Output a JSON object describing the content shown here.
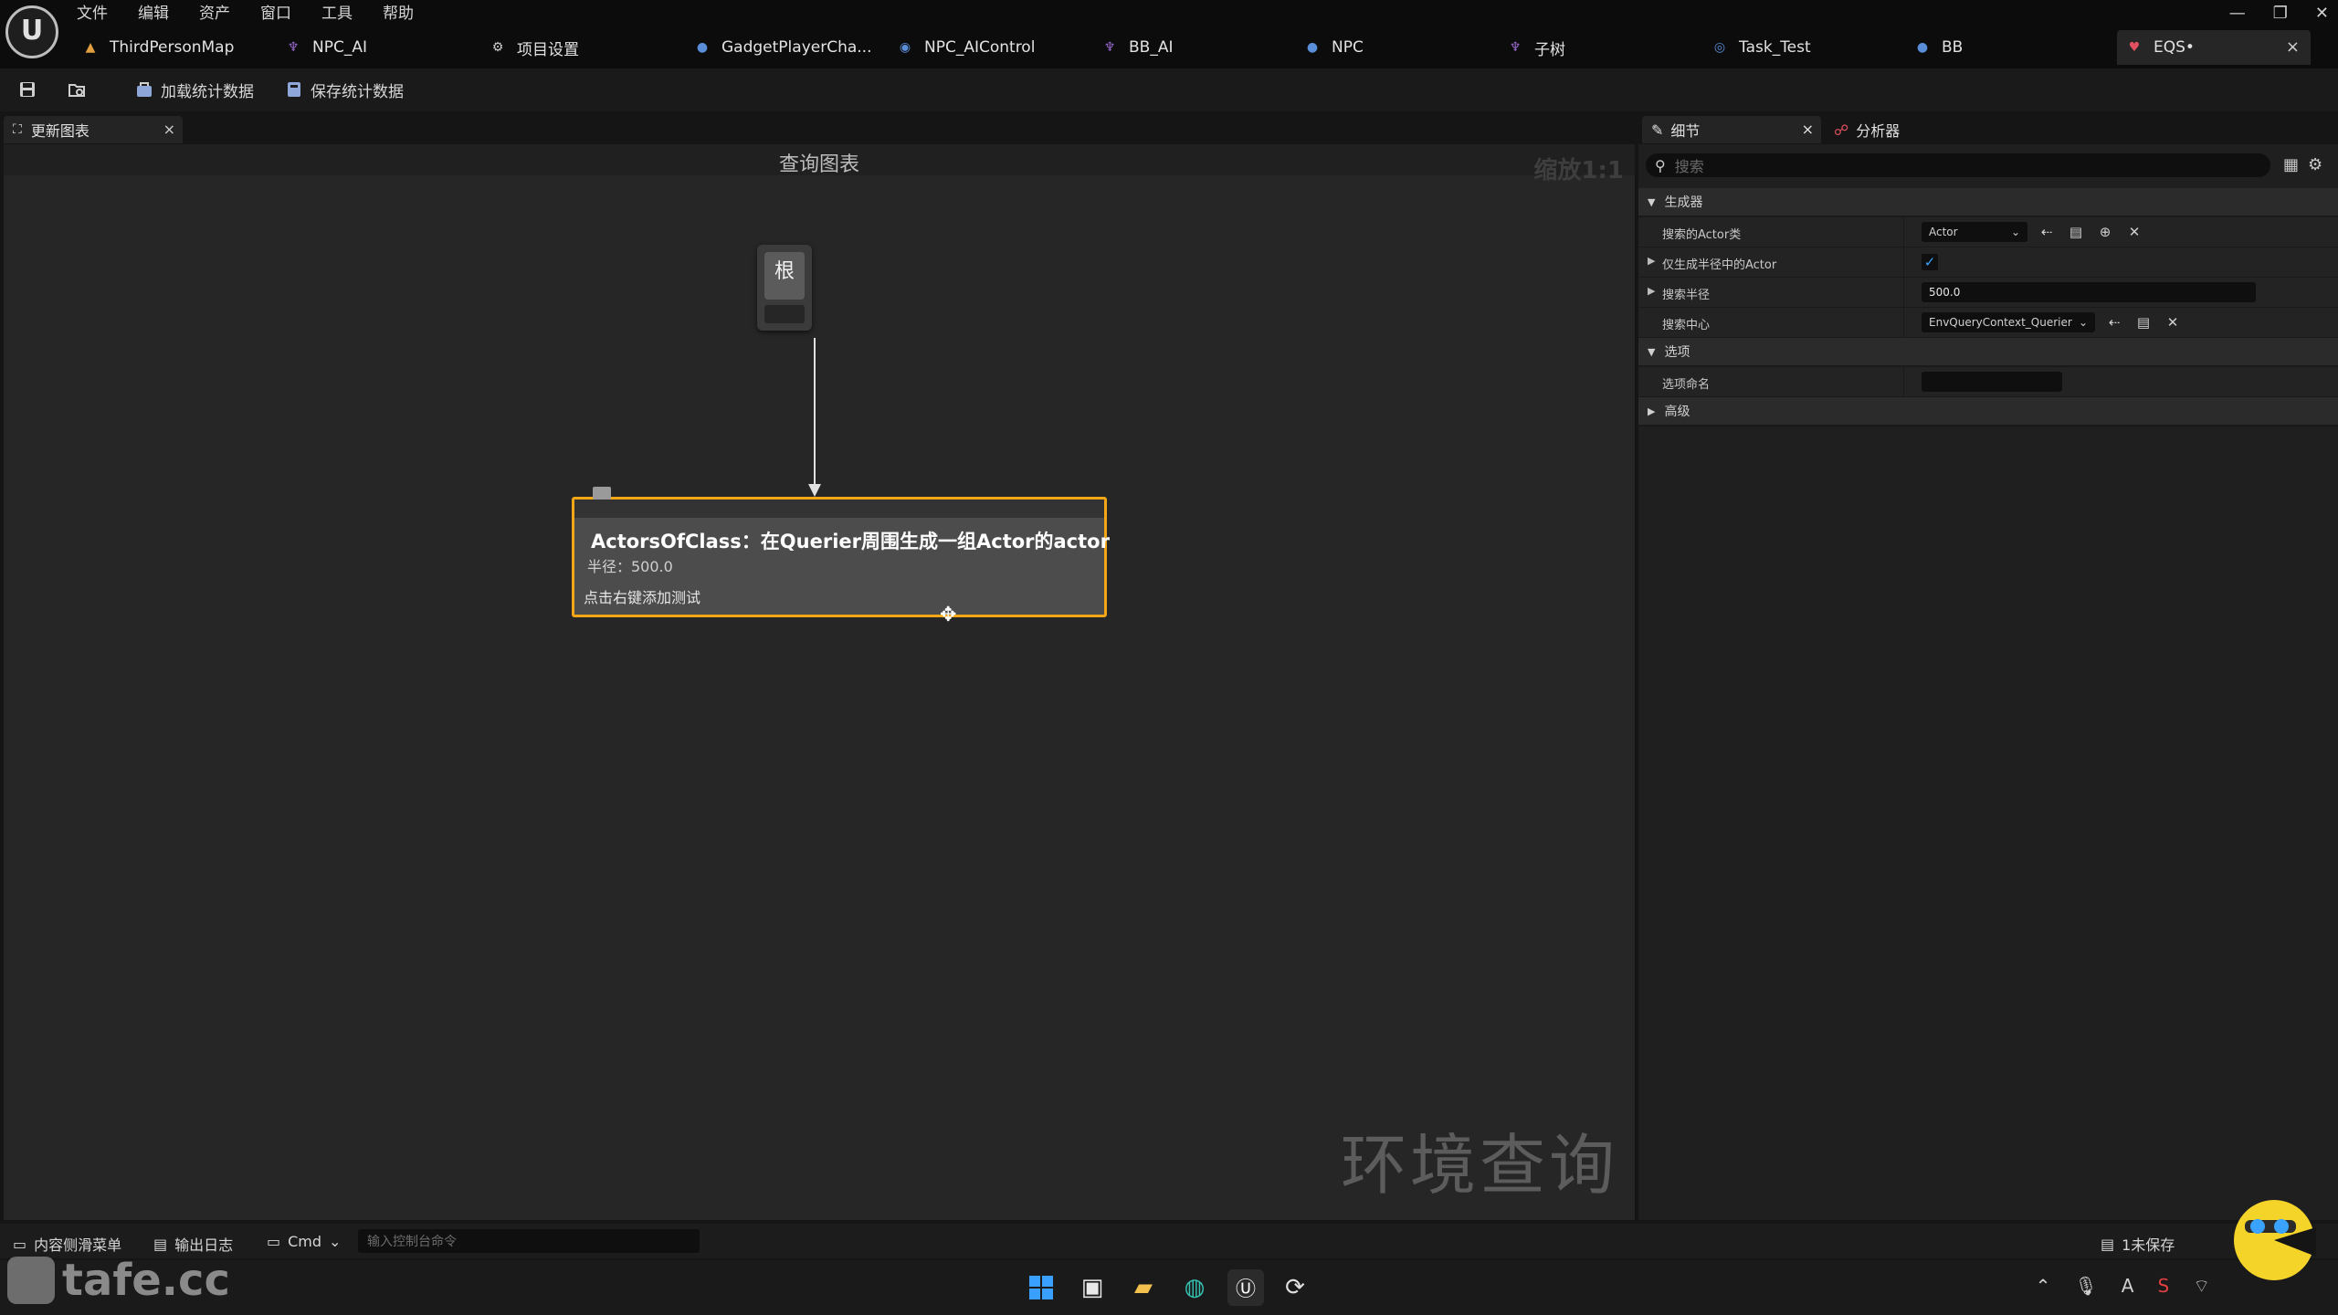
{
  "menu": [
    "文件",
    "编辑",
    "资产",
    "窗口",
    "工具",
    "帮助"
  ],
  "tabs": [
    {
      "label": "ThirdPersonMap",
      "icon": "map-icon"
    },
    {
      "label": "NPC_AI",
      "icon": "behavior-tree-icon"
    },
    {
      "label": "项目设置",
      "icon": "settings-icon"
    },
    {
      "label": "GadgetPlayerCha...",
      "icon": "blueprint-character-icon"
    },
    {
      "label": "NPC_AIControl",
      "icon": "ai-controller-icon"
    },
    {
      "label": "BB_AI",
      "icon": "behavior-tree-icon"
    },
    {
      "label": "NPC",
      "icon": "blueprint-character-icon"
    },
    {
      "label": "子树",
      "icon": "behavior-tree-icon"
    },
    {
      "label": "Task_Test",
      "icon": "task-icon"
    },
    {
      "label": "BB",
      "icon": "blueprint-character-icon"
    },
    {
      "label": "EQS•",
      "icon": "eqs-icon",
      "active": true
    }
  ],
  "toolbar": {
    "load_stats": "加载统计数据",
    "save_stats": "保存统计数据"
  },
  "graph": {
    "tab_label": "更新图表",
    "title": "查询图表",
    "zoom": "缩放1:1",
    "watermark": "环境查询",
    "root_label": "根",
    "generator": {
      "title": "ActorsOfClass：在Querier周围生成一组Actor的actor",
      "subtitle": "半径：500.0",
      "hint": "点击右键添加测试"
    }
  },
  "details": {
    "tab_details": "细节",
    "tab_profiler": "分析器",
    "search_placeholder": "搜索",
    "categories": {
      "generator": "生成器",
      "options": "选项",
      "advanced": "高级"
    },
    "props": {
      "actor_class_label": "搜索的Actor类",
      "actor_class_value": "Actor",
      "only_in_radius_label": "仅生成半径中的Actor",
      "only_in_radius_checked": true,
      "radius_label": "搜索半径",
      "radius_value": "500.0",
      "center_label": "搜索中心",
      "center_value": "EnvQueryContext_Querier",
      "option_name_label": "选项命名",
      "option_name_value": ""
    }
  },
  "status": {
    "content_drawer": "内容侧滑菜单",
    "output_log": "输出日志",
    "cmd": "Cmd",
    "console_placeholder": "输入控制台命令",
    "unsaved": "1未保存"
  },
  "site_watermark": "tafe.cc",
  "colors": {
    "selection_border": "#f3a616",
    "accent_blue": "#3aa3ff"
  }
}
